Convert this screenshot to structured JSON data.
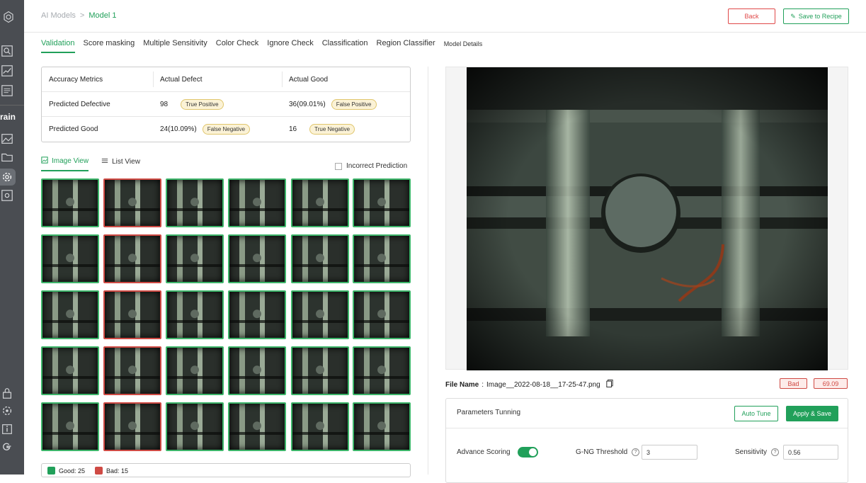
{
  "sidebar": {
    "section_label": "rain",
    "icons": [
      "logo-icon",
      "search-icon",
      "chart-icon",
      "report-icon",
      "image-icon",
      "folder-icon",
      "gear-icon",
      "model-icon",
      "lock-icon",
      "settings-icon",
      "info-icon",
      "google-icon"
    ]
  },
  "breadcrumb": {
    "root": "AI Models",
    "separator": ">",
    "current": "Model 1"
  },
  "toolbar": {
    "back_label": "Back",
    "save_label": "Save to Recipe"
  },
  "tabs": [
    {
      "label": "Validation"
    },
    {
      "label": "Score masking"
    },
    {
      "label": "Multiple Sensitivity"
    },
    {
      "label": "Color Check"
    },
    {
      "label": "Ignore Check"
    },
    {
      "label": "Classification"
    },
    {
      "label": "Region Classifier"
    },
    {
      "label": "Model Details"
    }
  ],
  "metrics": {
    "headers": [
      "Accuracy Metrics",
      "Actual Defect",
      "Actual Good"
    ],
    "rows": [
      {
        "label": "Predicted Defective",
        "defect_value": "98",
        "defect_tag": "True Positive",
        "good_value": "36(09.01%)",
        "good_tag": "False Positive"
      },
      {
        "label": "Predicted Good",
        "defect_value": "24(10.09%)",
        "defect_tag": "False Negative",
        "good_value": "16",
        "good_tag": "True Negative"
      }
    ]
  },
  "view": {
    "image_view": "Image View",
    "list_view": "List View",
    "incorrect_label": "Incorrect Prediction"
  },
  "thumbnails": {
    "columns": 6,
    "rows": 5,
    "bad_column": 1
  },
  "legend": {
    "good": "Good: 25",
    "bad": "Bad: 15"
  },
  "viewer": {
    "file_name_label": "File Name",
    "file_name": "Image__2022-08-18__17-25-47.png",
    "result": "Bad",
    "score": "69.09"
  },
  "params": {
    "title": "Parameters Tunning",
    "auto_tune": "Auto Tune",
    "apply_save": "Apply & Save",
    "advance_scoring_label": "Advance Scoring",
    "advance_scoring_on": true,
    "threshold_label": "G-NG Threshold",
    "threshold_value": "3",
    "sensitivity_label": "Sensitivity",
    "sensitivity_value": "0.56"
  },
  "colors": {
    "accent": "#21a05a",
    "danger": "#cf4a44",
    "sidebar": "#4a4d52",
    "tag_bg": "#fbf2d6"
  }
}
